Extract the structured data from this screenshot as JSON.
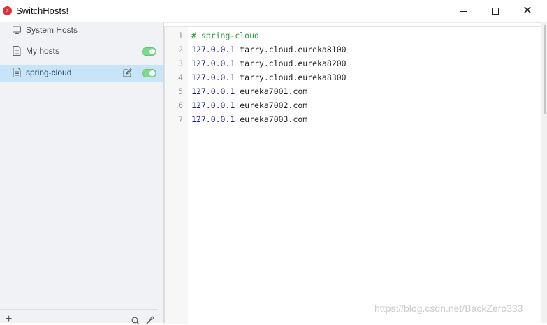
{
  "window": {
    "title": "SwitchHosts!",
    "close_glyph": "✕"
  },
  "sidebar": {
    "items": [
      {
        "label": "System Hosts",
        "icon": "monitor-icon",
        "selected": false,
        "toggle": false
      },
      {
        "label": "My hosts",
        "icon": "file-icon",
        "selected": false,
        "toggle": true
      },
      {
        "label": "spring-cloud",
        "icon": "file-icon",
        "selected": true,
        "toggle": true,
        "editable": true
      }
    ],
    "add_glyph": "+"
  },
  "editor": {
    "lines": [
      {
        "num": "1",
        "comment": "# spring-cloud",
        "ip": "",
        "host": ""
      },
      {
        "num": "2",
        "comment": "",
        "ip": "127.0.0.1",
        "host": " tarry.cloud.eureka8100"
      },
      {
        "num": "3",
        "comment": "",
        "ip": "127.0.0.1",
        "host": " tarry.cloud.eureka8200"
      },
      {
        "num": "4",
        "comment": "",
        "ip": "127.0.0.1",
        "host": " tarry.cloud.eureka8300"
      },
      {
        "num": "5",
        "comment": "",
        "ip": "127.0.0.1",
        "host": " eureka7001.com"
      },
      {
        "num": "6",
        "comment": "",
        "ip": "127.0.0.1",
        "host": " eureka7002.com"
      },
      {
        "num": "7",
        "comment": "",
        "ip": "127.0.0.1",
        "host": " eureka7003.com"
      }
    ]
  },
  "watermark": "https://blog.csdn.net/BackZero333",
  "colors": {
    "selected_item_bg": "#c7e4f9",
    "toggle_on": "#7ed98d",
    "comment": "#2e9b3c",
    "ip": "#1a1aa6",
    "logo": "#d9333f"
  }
}
